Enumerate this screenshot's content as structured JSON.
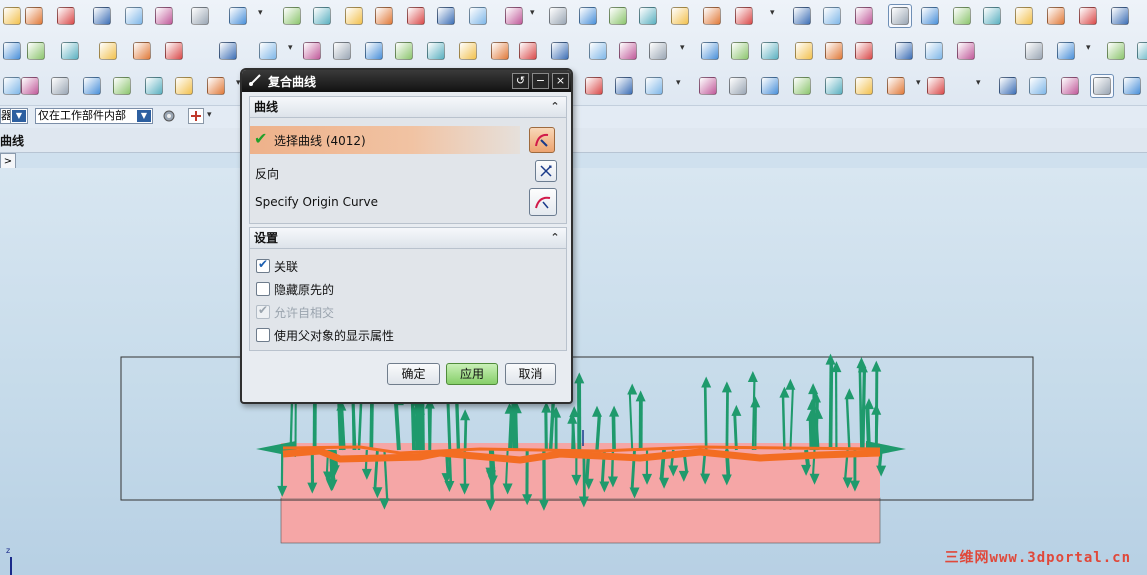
{
  "toolbar": {
    "selection_filter_short": "器",
    "selection_scope": "仅在工作部件内部"
  },
  "strip": {
    "title": "曲线"
  },
  "dialog": {
    "title": "复合曲线",
    "title_buttons": {
      "reset": "↺",
      "minimize": "−",
      "close": "×"
    },
    "curve_section": {
      "title": "曲线",
      "select_curve_label": "选择曲线 (4012)",
      "reverse_label": "反向",
      "origin_curve_label": "Specify Origin Curve"
    },
    "settings_section": {
      "title": "设置",
      "options": [
        {
          "label": "关联",
          "checked": true,
          "enabled": true
        },
        {
          "label": "隐藏原先的",
          "checked": false,
          "enabled": true
        },
        {
          "label": "允许自相交",
          "checked": true,
          "enabled": false
        },
        {
          "label": "使用父对象的显示属性",
          "checked": false,
          "enabled": true
        }
      ]
    },
    "buttons": {
      "ok": "确定",
      "apply": "应用",
      "cancel": "取消"
    }
  },
  "canvas": {
    "axis_label": "z",
    "watermark": "三维网www.3dportal.cn"
  },
  "colors": {
    "curve_highlight": "#f36d22",
    "vector_green": "#1f9a6c",
    "block_pink": "#f5a6a6"
  }
}
